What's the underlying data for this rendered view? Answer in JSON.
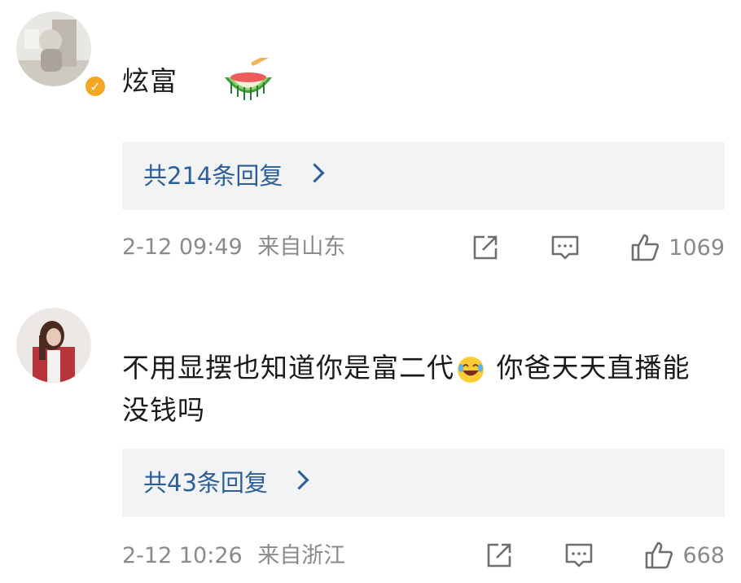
{
  "comments": [
    {
      "text": "炫富",
      "emoji": "watermelon-emoji",
      "replies_label": "共214条回复",
      "timestamp": "2-12 09:49",
      "location": "来自山东",
      "likes": "1069",
      "verified": true
    },
    {
      "text": "不用显摆也知道你是富二代",
      "emoji": "laughing-emoji",
      "text_after": " 你爸天天直播能没钱吗",
      "replies_label": "共43条回复",
      "timestamp": "2-12 10:26",
      "location": "来自浙江",
      "likes": "668",
      "verified": false
    }
  ],
  "colors": {
    "link": "#2b5d9a",
    "meta": "#8a8a8a",
    "reply_bg": "#f2f3f5",
    "badge": "#f5a623"
  }
}
